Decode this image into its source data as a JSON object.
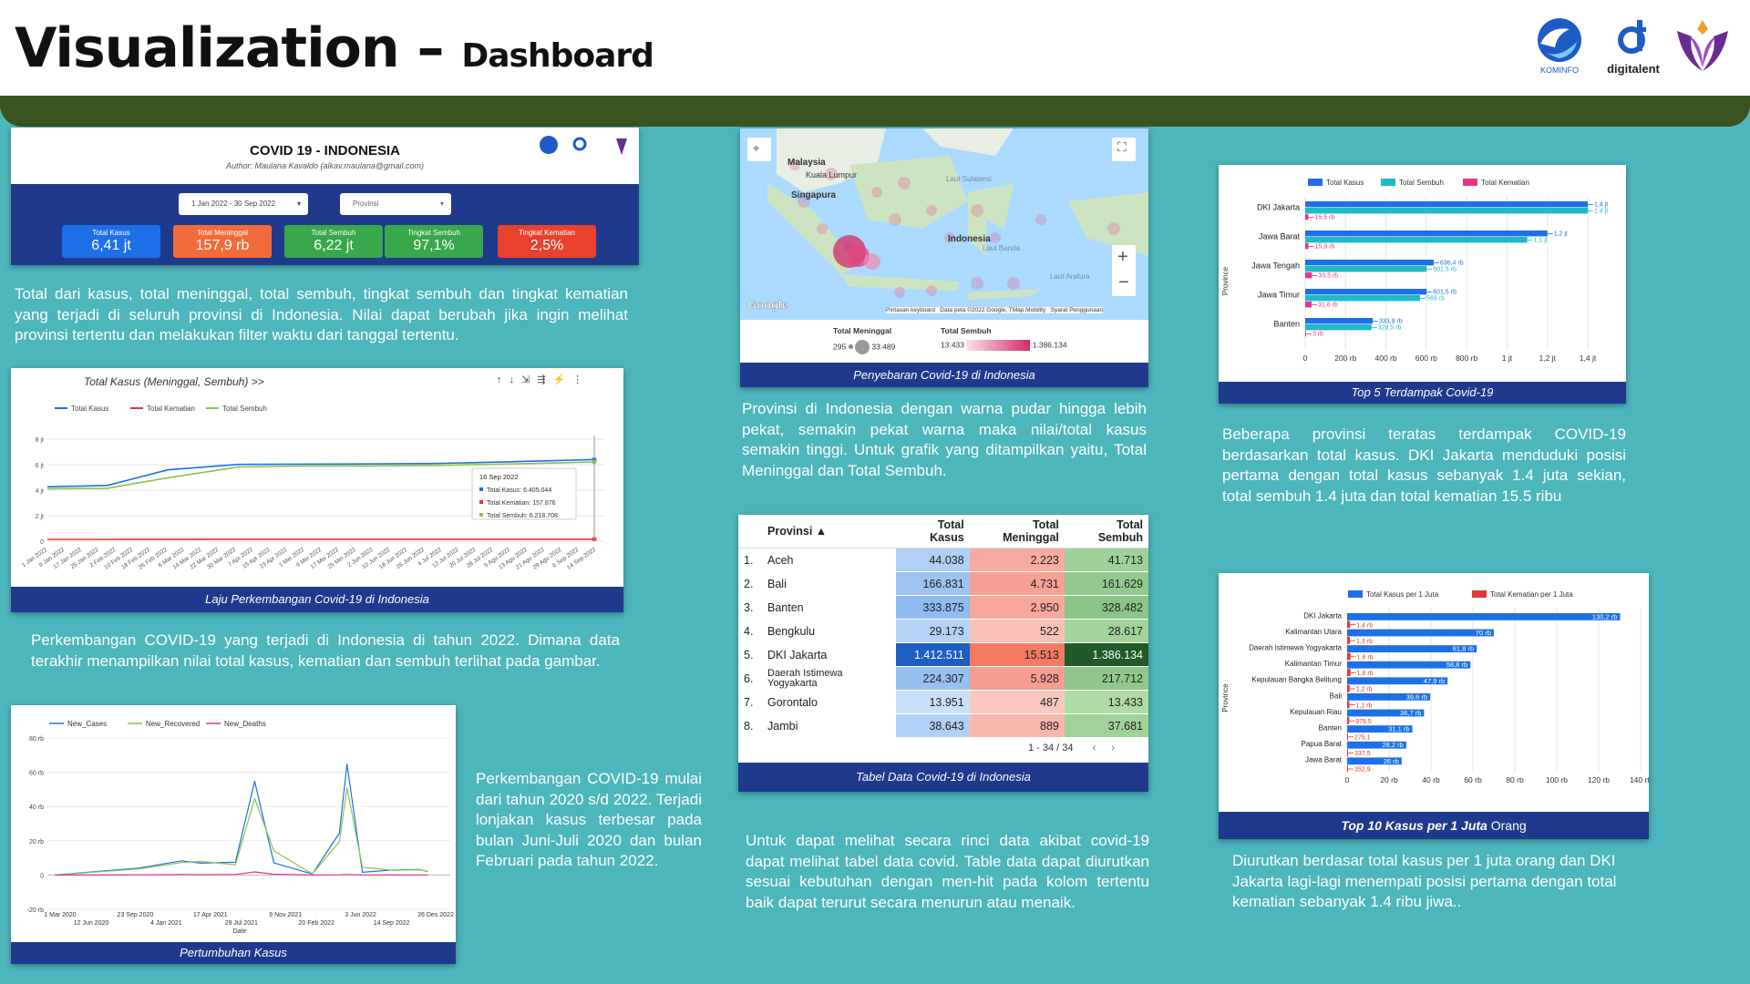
{
  "header": {
    "title": "Visualization –",
    "subtitle": "Dashboard",
    "logos": [
      "KOMINFO",
      "digitalent"
    ]
  },
  "overview": {
    "title": "COVID 19 - INDONESIA",
    "author": "Author: Maulana Kavaldo (alkav.maulana@gmail.com)",
    "date_range": "1 Jan 2022 - 30 Sep 2022",
    "province_placeholder": "Provinsi",
    "kpis": [
      {
        "label": "Total Kasus",
        "value": "6,41 jt",
        "color": "#1e6fe8"
      },
      {
        "label": "Total Meninggal",
        "value": "157,9 rb",
        "color": "#f26b3a"
      },
      {
        "label": "Total Sembuh",
        "value": "6,22 jt",
        "color": "#38a84a"
      },
      {
        "label": "Tingkat Sembuh",
        "value": "97,1%",
        "color": "#38a84a"
      },
      {
        "label": "Tingkat Kematian",
        "value": "2,5%",
        "color": "#e8412e"
      }
    ],
    "description": "Total dari kasus, total meninggal, total sembuh, tingkat sembuh dan tingkat kematian yang terjadi di seluruh provinsi di Indonesia. Nilai dapat berubah jika ingin melihat provinsi tertentu dan melakukan filter waktu dari tanggal tertentu."
  },
  "trend": {
    "chart_title": "Total Kasus (Meninggal, Sembuh) >>",
    "legend": [
      "Total Kasus",
      "Total Kematian",
      "Total Sembuh"
    ],
    "y_ticks": [
      "8 jt",
      "6 jt",
      "4 jt",
      "2 jt",
      "0"
    ],
    "x_ticks": [
      "1 Jan 2022",
      "9 Jan 2022",
      "17 Jan 2022",
      "25 Jan 2022",
      "2 Feb 2022",
      "10 Feb 2022",
      "18 Feb 2022",
      "26 Feb 2022",
      "6 Mar 2022",
      "14 Mar 2022",
      "22 Mar 2022",
      "30 Mar 2022",
      "7 Apr 2022",
      "15 Apr 2022",
      "23 Apr 2022",
      "1 Mei 2022",
      "9 Mei 2022",
      "17 Mei 2022",
      "25 Mei 2022",
      "2 Jun 2022",
      "10 Jun 2022",
      "18 Jun 2022",
      "26 Jun 2022",
      "4 Jul 2022",
      "12 Jul 2022",
      "20 Jul 2022",
      "28 Jul 2022",
      "5 Agu 2022",
      "13 Agu 2022",
      "21 Agu 2022",
      "29 Agu 2022",
      "6 Sep 2022",
      "14 Sep 2022"
    ],
    "tooltip": {
      "date": "16 Sep 2022",
      "lines": [
        "Total Kasus: 6.405.044",
        "Total Kematian: 157.876",
        "Total Sembuh: 6.218.708"
      ]
    },
    "caption": "Laju Perkembangan Covid-19 di Indonesia",
    "description": "Perkembangan COVID-19 yang terjadi di Indonesia di tahun 2022. Dimana data terakhir menampilkan nilai total kasus, kematian dan sembuh terlihat pada gambar."
  },
  "growth": {
    "legend": [
      "New_Cases",
      "New_Recovered",
      "New_Deaths"
    ],
    "y_ticks": [
      "80 rb",
      "60 rb",
      "40 rb",
      "20 rb",
      "0",
      "-20 rb"
    ],
    "x_ticks_top": [
      "1 Mar 2020",
      "23 Sep 2020",
      "17 Apr 2021",
      "9 Nov 2021",
      "3 Jun 2022",
      "26 Des 2022"
    ],
    "x_ticks_bottom": [
      "12 Jun 2020",
      "4 Jan 2021",
      "29 Jul 2021",
      "20 Feb 2022",
      "14 Sep 2022"
    ],
    "x_label": "Date",
    "caption": "Pertumbuhan Kasus",
    "description": "Perkembangan COVID-19 mulai dari tahun 2020 s/d 2022. Terjadi lonjakan kasus terbesar pada bulan Juni-Juli 2020 dan bulan Februari pada tahun 2022."
  },
  "map": {
    "labels": [
      "Malaysia",
      "Kuala Lumpur",
      "Singapura",
      "Indonesia",
      "Laut Sulawesi",
      "Laut Banda",
      "Laut Arafura",
      "Google"
    ],
    "footer": "Pintasan keyboard   Data peta ©2022 Google, TMap Mobility   Syarat Penggunaan",
    "legend_deaths_title": "Total Meninggal",
    "legend_deaths_min": "295",
    "legend_deaths_max": "33.489",
    "legend_recovered_title": "Total Sembuh",
    "legend_recovered_min": "13.433",
    "legend_recovered_max": "1.386.134",
    "caption": "Penyebaran Covid-19 di Indonesia",
    "description": "Provinsi di Indonesia dengan warna pudar hingga lebih pekat, semakin pekat warna maka nilai/total kasus semakin tinggi. Untuk grafik yang ditampilkan yaitu, Total Meninggal dan Total Sembuh."
  },
  "table": {
    "headers": [
      "Provinsi ▲",
      "Total Kasus",
      "Total Meninggal",
      "Total Sembuh"
    ],
    "rows": [
      [
        "1.",
        "Aceh",
        "44.038",
        "2.223",
        "41.713"
      ],
      [
        "2.",
        "Bali",
        "166.831",
        "4.731",
        "161.629"
      ],
      [
        "3.",
        "Banten",
        "333.875",
        "2.950",
        "328.482"
      ],
      [
        "4.",
        "Bengkulu",
        "29.173",
        "522",
        "28.617"
      ],
      [
        "5.",
        "DKI Jakarta",
        "1.412.511",
        "15.513",
        "1.386.134"
      ],
      [
        "6.",
        "Daerah Istimewa Yogyakarta",
        "224.307",
        "5.928",
        "217.712"
      ],
      [
        "7.",
        "Gorontalo",
        "13.951",
        "487",
        "13.433"
      ],
      [
        "8.",
        "Jambi",
        "38.643",
        "889",
        "37.681"
      ]
    ],
    "pagination": "1 - 34 / 34",
    "caption": "Tabel Data Covid-19 di Indonesia",
    "description": "Untuk dapat melihat secara rinci data akibat covid-19 dapat melihat tabel data covid. Table data dapat diurutkan sesuai kebutuhan dengan men-hit pada kolom tertentu baik dapat terurut secara menurun atau menaik."
  },
  "top5": {
    "legend": [
      "Total Kasus",
      "Total Sembuh",
      "Total Kematian"
    ],
    "y_axis_label": "Province",
    "categories": [
      "DKI Jakarta",
      "Jawa Barat",
      "Jawa Tengah",
      "Jawa Timur",
      "Banten"
    ],
    "kasus_labels": [
      "1,4 jt",
      "1,2 jt",
      "636,4 rb",
      "601,5 rb",
      "333,9 rb"
    ],
    "sembuh_labels": [
      "1,4 jt",
      "1,1 jt",
      "601,5 rb",
      "569 rb",
      "328,5 rb"
    ],
    "kematian_labels": [
      "15,5 rb",
      "15,9 rb",
      "33,5 rb",
      "31,8 rb",
      "3 rb"
    ],
    "x_ticks": [
      "0",
      "200 rb",
      "400 rb",
      "600 rb",
      "800 rb",
      "1 jt",
      "1,2 jt",
      "1,4 jt"
    ],
    "caption": "Top 5 Terdampak Covid-19",
    "description": "Beberapa provinsi teratas terdampak COVID-19 berdasarkan total kasus. DKI Jakarta menduduki posisi pertama dengan total kasus sebanyak 1.4 juta sekian, total sembuh 1.4 juta dan total kematian 15.5 ribu"
  },
  "top10": {
    "legend": [
      "Total Kasus per 1 Juta",
      "Total Kematian per 1 Juta"
    ],
    "y_axis_label": "Province",
    "categories": [
      "DKI Jakarta",
      "Kalimantan Utara",
      "Daerah Istimewa Yogyakarta",
      "Kalimantan Timur",
      "Kepulauan Bangka Belitung",
      "Bali",
      "Kepulauan Riau",
      "Banten",
      "Papua Barat",
      "Jawa Barat"
    ],
    "kasus_labels": [
      "130,2 rb",
      "70 rb",
      "61,8 rb",
      "58,8 rb",
      "47,9 rb",
      "39,6 rb",
      "36,7 rb",
      "31,1 rb",
      "28,2 rb",
      "26 rb"
    ],
    "kematian_labels": [
      "1,4 rb",
      "1,3 rb",
      "1,6 rb",
      "1,6 rb",
      "1,2 rb",
      "1,1 rb",
      "978,5",
      "275,1",
      "337,5",
      "352,9"
    ],
    "x_ticks": [
      "0",
      "20 rb",
      "40 rb",
      "60 rb",
      "80 rb",
      "100 rb",
      "120 rb",
      "140 rb"
    ],
    "caption_main": "Top 10 Kasus per 1 Juta",
    "caption_rest": "Orang",
    "description": "Diurutkan berdasar total kasus per 1 juta orang dan DKI Jakarta lagi-lagi menempati posisi pertama dengan total kematian sebanyak 1.4 ribu jiwa.."
  },
  "chart_data": [
    {
      "type": "bar",
      "title": "Top 5 Terdampak Covid-19",
      "categories": [
        "DKI Jakarta",
        "Jawa Barat",
        "Jawa Tengah",
        "Jawa Timur",
        "Banten"
      ],
      "series": [
        {
          "name": "Total Kasus",
          "values": [
            1400000,
            1200000,
            636400,
            601500,
            333900
          ],
          "color": "#1e6fe8"
        },
        {
          "name": "Total Sembuh",
          "values": [
            1400000,
            1100000,
            601500,
            569000,
            328500
          ],
          "color": "#20b9c8"
        },
        {
          "name": "Total Kematian",
          "values": [
            15500,
            15900,
            33500,
            31800,
            3000
          ],
          "color": "#e8348c"
        }
      ],
      "xlim": [
        0,
        1400000
      ]
    },
    {
      "type": "bar",
      "title": "Top 10 Kasus per 1 Juta Orang",
      "categories": [
        "DKI Jakarta",
        "Kalimantan Utara",
        "Daerah Istimewa Yogyakarta",
        "Kalimantan Timur",
        "Kepulauan Bangka Belitung",
        "Bali",
        "Kepulauan Riau",
        "Banten",
        "Papua Barat",
        "Jawa Barat"
      ],
      "series": [
        {
          "name": "Total Kasus per 1 Juta",
          "values": [
            130200,
            70000,
            61800,
            58800,
            47900,
            39600,
            36700,
            31100,
            28200,
            26000
          ],
          "color": "#1e6fe8"
        },
        {
          "name": "Total Kematian per 1 Juta",
          "values": [
            1400,
            1300,
            1600,
            1600,
            1200,
            1100,
            978.5,
            275.1,
            337.5,
            352.9
          ],
          "color": "#e53935"
        }
      ],
      "xlim": [
        0,
        140000
      ]
    },
    {
      "type": "line",
      "title": "Total Kasus (Meninggal, Sembuh) >>",
      "x": [
        "1 Jan 2022",
        "1 Feb 2022",
        "1 Mar 2022",
        "1 Apr 2022",
        "1 Mei 2022",
        "1 Jun 2022",
        "1 Jul 2022",
        "1 Agu 2022",
        "1 Sep 2022",
        "16 Sep 2022"
      ],
      "series": [
        {
          "name": "Total Kasus",
          "values": [
            4263000,
            4370000,
            5590000,
            6020000,
            6046000,
            6056000,
            6096000,
            6205000,
            6340000,
            6405044
          ],
          "color": "#1e6fe8"
        },
        {
          "name": "Total Kematian",
          "values": [
            144100,
            144400,
            149000,
            155400,
            156300,
            156600,
            156800,
            157100,
            157600,
            157876
          ],
          "color": "#e53935"
        },
        {
          "name": "Total Sembuh",
          "values": [
            4114000,
            4150000,
            4970000,
            5820000,
            5890000,
            5900000,
            5940000,
            6040000,
            6160000,
            6218708
          ],
          "color": "#8bc34a"
        }
      ],
      "ylim": [
        0,
        8000000
      ]
    },
    {
      "type": "line",
      "title": "",
      "x": [
        "1 Mar 2020",
        "1 Sep 2020",
        "1 Jan 2021",
        "1 Mar 2021",
        "1 Jun 2021",
        "15 Jul 2021",
        "1 Sep 2021",
        "1 Dec 2021",
        "1 Feb 2022",
        "16 Feb 2022",
        "1 Apr 2022",
        "1 Jul 2022",
        "1 Sep 2022",
        "14 Sep 2022"
      ],
      "series": [
        {
          "name": "New_Cases",
          "values": [
            0,
            3500,
            9000,
            6000,
            8000,
            54000,
            8000,
            200,
            25000,
            64000,
            2000,
            2500,
            3500,
            2000
          ],
          "color": "#1e6fe8"
        },
        {
          "name": "New_Recovered",
          "values": [
            0,
            3000,
            8000,
            7000,
            6500,
            44000,
            15000,
            300,
            20000,
            50000,
            5000,
            2300,
            3400,
            2200
          ],
          "color": "#8bc34a"
        },
        {
          "name": "New_Deaths",
          "values": [
            0,
            100,
            250,
            200,
            300,
            1800,
            500,
            5,
            100,
            300,
            50,
            20,
            30,
            20
          ],
          "color": "#e8348c"
        }
      ],
      "ylim": [
        -20000,
        80000
      ]
    }
  ]
}
